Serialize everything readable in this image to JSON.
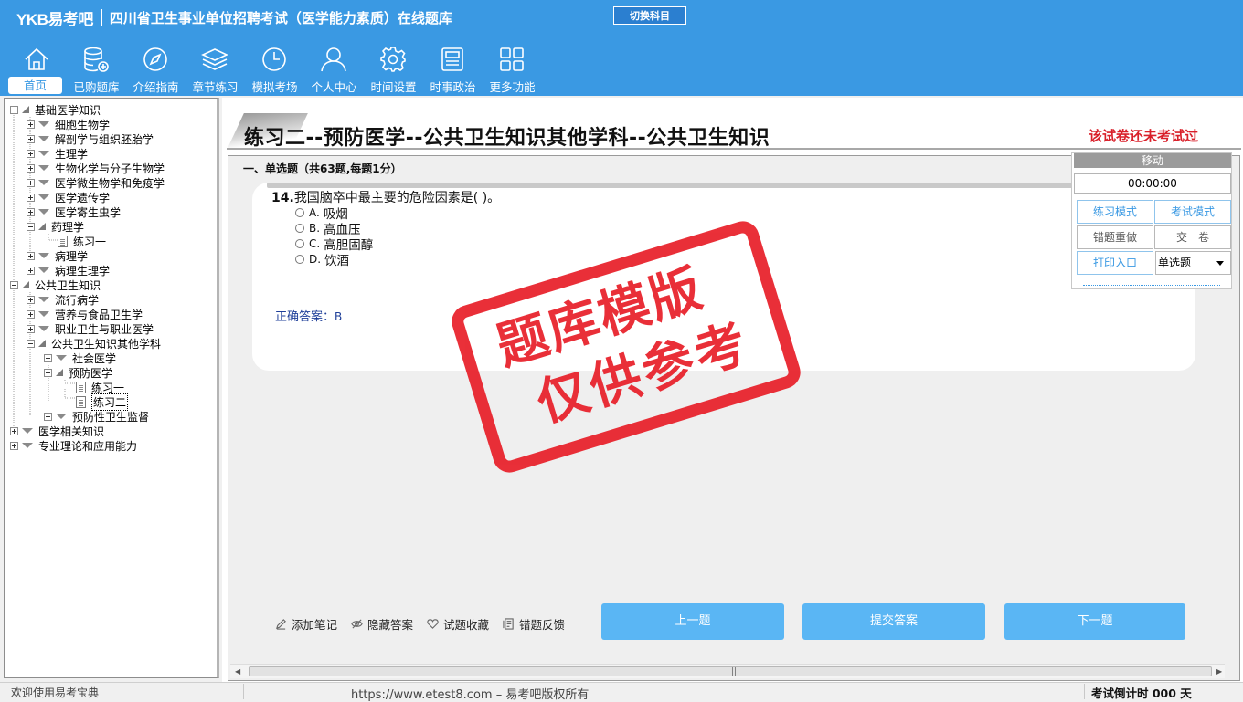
{
  "header": {
    "logo": "YKB易考吧",
    "title": "四川省卫生事业单位招聘考试（医学能力素质）在线题库",
    "switch_label": "切换科目",
    "nav": [
      {
        "label": "首页",
        "icon": "home-icon"
      },
      {
        "label": "已购题库",
        "icon": "database-icon"
      },
      {
        "label": "介绍指南",
        "icon": "compass-icon"
      },
      {
        "label": "章节练习",
        "icon": "layers-icon"
      },
      {
        "label": "模拟考场",
        "icon": "clock-icon"
      },
      {
        "label": "个人中心",
        "icon": "user-icon"
      },
      {
        "label": "时间设置",
        "icon": "gear-icon"
      },
      {
        "label": "时事政治",
        "icon": "news-icon"
      },
      {
        "label": "更多功能",
        "icon": "grid-icon"
      }
    ]
  },
  "tree": [
    {
      "label": "基础医学知识"
    },
    {
      "label": "细胞生物学"
    },
    {
      "label": "解剖学与组织胚胎学"
    },
    {
      "label": "生理学"
    },
    {
      "label": "生物化学与分子生物学"
    },
    {
      "label": "医学微生物学和免疫学"
    },
    {
      "label": "医学遗传学"
    },
    {
      "label": "医学寄生虫学"
    },
    {
      "label": "药理学"
    },
    {
      "label": "练习一"
    },
    {
      "label": "病理学"
    },
    {
      "label": "病理生理学"
    },
    {
      "label": "公共卫生知识"
    },
    {
      "label": "流行病学"
    },
    {
      "label": "营养与食品卫生学"
    },
    {
      "label": "职业卫生与职业医学"
    },
    {
      "label": "公共卫生知识其他学科"
    },
    {
      "label": "社会医学"
    },
    {
      "label": "预防医学"
    },
    {
      "label": "练习一"
    },
    {
      "label": "练习二"
    },
    {
      "label": "预防性卫生监督"
    },
    {
      "label": "医学相关知识"
    },
    {
      "label": "专业理论和应用能力"
    }
  ],
  "paper": {
    "title": "练习二--预防医学--公共卫生知识其他学科--公共卫生知识",
    "status": "该试卷还未考试过",
    "section": "一、单选题（共63题,每题1分）"
  },
  "question": {
    "number": "14.",
    "text": "我国脑卒中最主要的危险因素是( )。",
    "options": [
      {
        "key": "A.",
        "text": "吸烟"
      },
      {
        "key": "B.",
        "text": "高血压"
      },
      {
        "key": "C.",
        "text": "高胆固醇"
      },
      {
        "key": "D.",
        "text": "饮酒"
      }
    ],
    "answer_label": "正确答案：",
    "answer_value": "B"
  },
  "stamp": {
    "line1": "题库模版",
    "line2": "仅供参考",
    "color": "#e8202a"
  },
  "tool": {
    "move_label": "移动",
    "timer": "00:00:00",
    "practice_mode": "练习模式",
    "exam_mode": "考试模式",
    "redo_wrong": "错题重做",
    "submit_paper": "交　卷",
    "print_entry": "打印入口",
    "question_type": "单选题"
  },
  "actions": {
    "add_note": "添加笔记",
    "hide_answer": "隐藏答案",
    "favorite": "试题收藏",
    "feedback": "错题反馈",
    "prev": "上一题",
    "submit": "提交答案",
    "next": "下一题"
  },
  "status_bar": {
    "welcome": "欢迎使用易考宝典",
    "copyright": "https://www.etest8.com – 易考吧版权所有",
    "countdown": "考试倒计时 000 天"
  },
  "colors": {
    "accent": "#3a99e3",
    "button": "#5ab6f4",
    "alert": "#d9202a"
  }
}
